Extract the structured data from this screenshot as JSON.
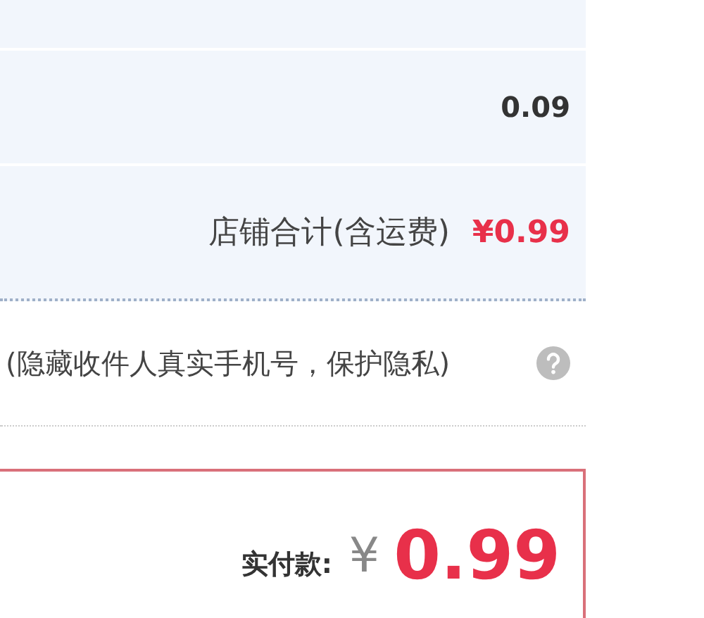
{
  "fee_row": {
    "value": "0.09"
  },
  "shop_total": {
    "label": "店铺合计(含运费)",
    "amount": "¥0.99"
  },
  "privacy_note": {
    "text": "(隐藏收件人真实手机号，保护隐私)"
  },
  "payment": {
    "label": "实付款:",
    "currency": "¥",
    "amount": "0.99"
  }
}
